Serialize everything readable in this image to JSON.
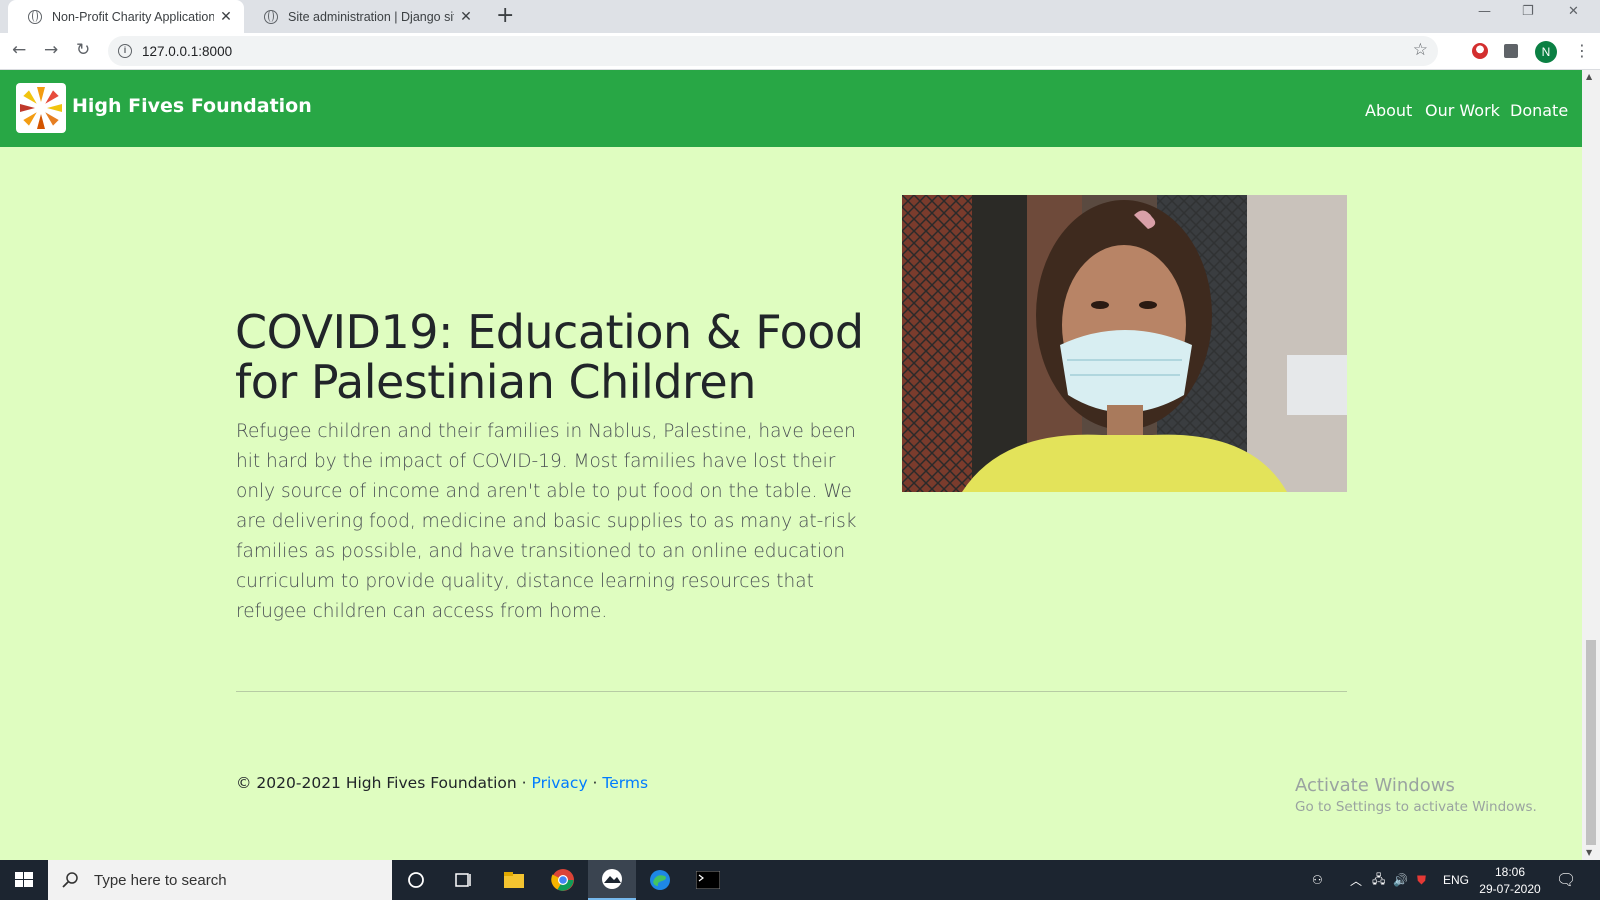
{
  "browser": {
    "tabs": [
      {
        "title": "Non-Profit Charity Application",
        "close": "✕"
      },
      {
        "title": "Site administration | Django site",
        "close": "✕"
      }
    ],
    "new_tab": "+",
    "url": "127.0.0.1:8000",
    "profile_initial": "N"
  },
  "site": {
    "brand": "High Fives Foundation",
    "nav": [
      "About",
      "Our Work",
      "Donate"
    ]
  },
  "hero": {
    "heading": "COVID19: Education & Food for Palestinian Children",
    "lead": "Refugee children and their families in Nablus, Palestine, have been hit hard by the impact of COVID-19. Most families have lost their only source of income and aren't able to put food on the table. We are delivering food, medicine and basic supplies to as many at-risk families as possible, and have transitioned to an online education curriculum to provide quality, distance learning resources that refugee children can access from home."
  },
  "footer": {
    "copyright": "© 2020-2021 High Fives Foundation · ",
    "privacy": "Privacy",
    "separator": " · ",
    "terms": "Terms"
  },
  "watermark": {
    "line1": "Activate Windows",
    "line2": "Go to Settings to activate Windows."
  },
  "taskbar": {
    "search_placeholder": "Type here to search",
    "language": "ENG",
    "time": "18:06",
    "date": "29-07-2020"
  },
  "colors": {
    "navbar": "#28a745",
    "page_bg": "#dffdc0",
    "link": "#007bff"
  }
}
